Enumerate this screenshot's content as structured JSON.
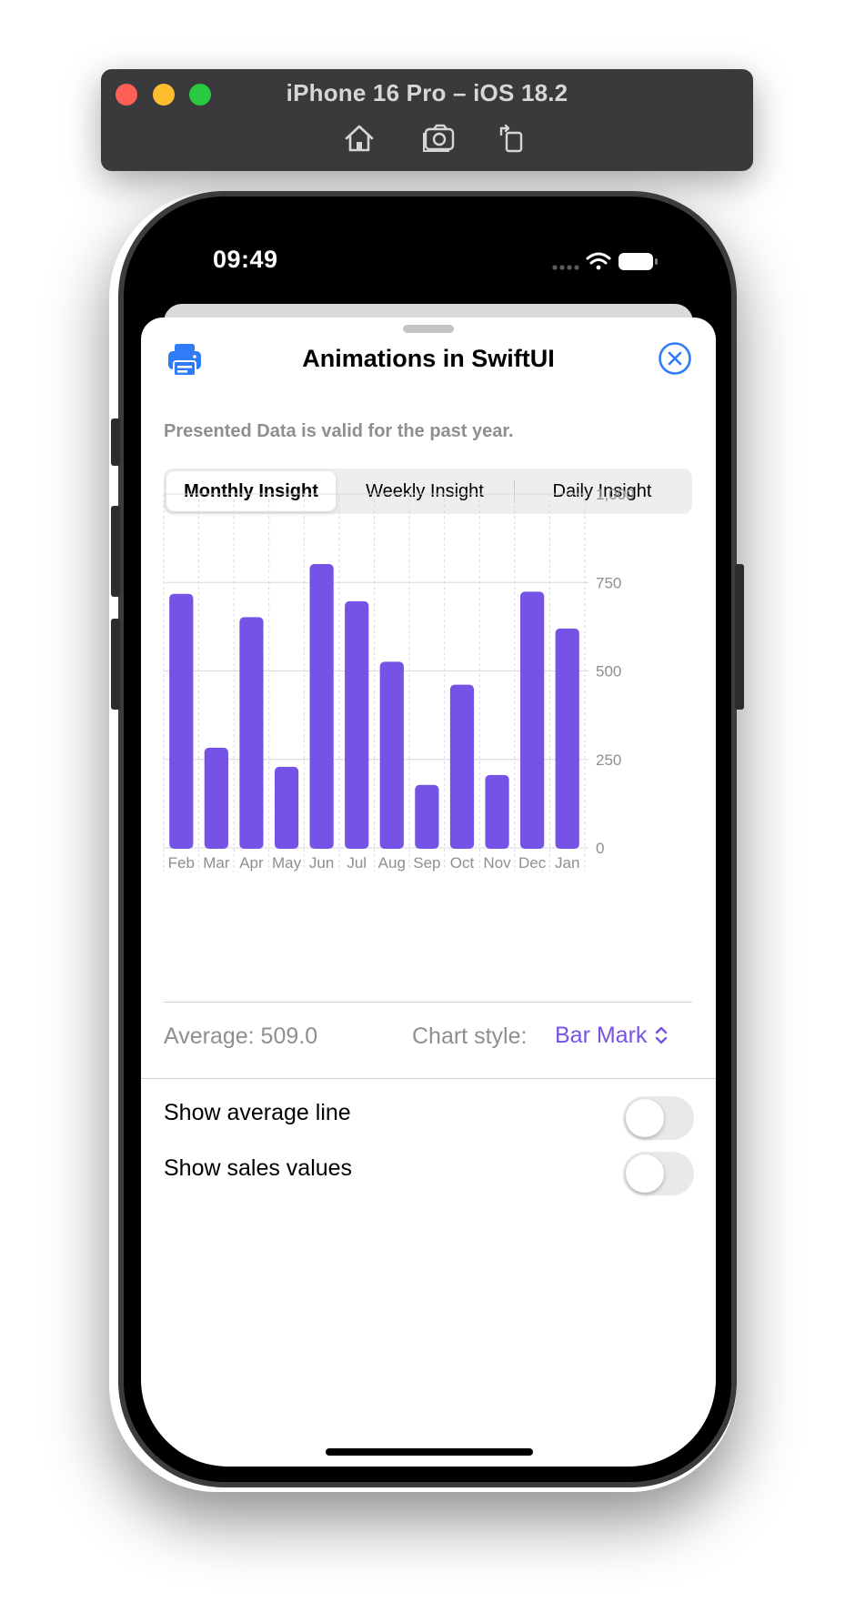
{
  "simulator": {
    "title": "iPhone 16 Pro – iOS 18.2",
    "tools": [
      "home-icon",
      "screenshot-icon",
      "rotate-icon"
    ]
  },
  "status_bar": {
    "time": "09:49",
    "icons": [
      "cellular-icon",
      "wifi-icon",
      "battery-icon"
    ]
  },
  "sheet": {
    "title": "Animations in SwiftUI",
    "subtitle": "Presented Data is valid for the past year.",
    "accent_color": "#2f7cf6"
  },
  "segmented": {
    "selected": "Monthly Insight",
    "options": [
      "Monthly Insight",
      "Weekly Insight",
      "Daily Insight"
    ]
  },
  "chart_data": {
    "type": "bar",
    "categories": [
      "Feb",
      "Mar",
      "Apr",
      "May",
      "Jun",
      "Jul",
      "Aug",
      "Sep",
      "Oct",
      "Nov",
      "Dec",
      "Jan"
    ],
    "values": [
      718,
      283,
      652,
      229,
      802,
      697,
      526,
      178,
      461,
      206,
      724,
      620
    ],
    "y_ticks": [
      "1,000",
      "750",
      "500",
      "250",
      "0"
    ],
    "ylim": [
      0,
      1000
    ],
    "color": "#7553e6",
    "grid": true
  },
  "summary": {
    "average_text": "Average: 509.0",
    "chart_style_label": "Chart style:",
    "chart_style_value": "Bar Mark"
  },
  "settings": {
    "show_average_line_label": "Show average line",
    "show_average_line": false,
    "show_sales_values_label": "Show sales values",
    "show_sales_values": false
  }
}
